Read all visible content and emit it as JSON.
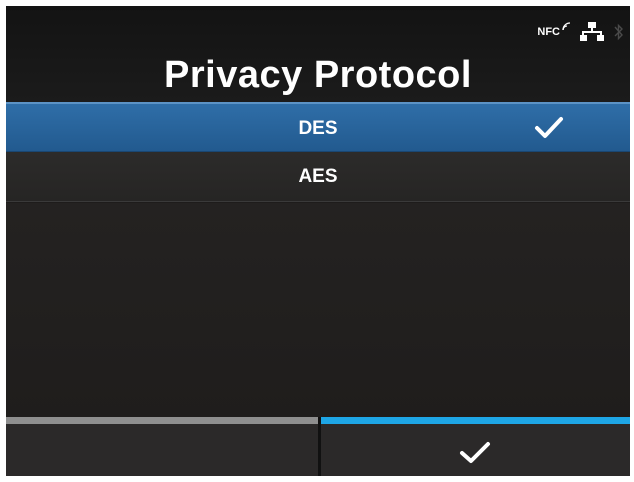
{
  "screen": {
    "title": "Privacy Protocol",
    "status": {
      "nfc_label": "NFC",
      "icons": [
        "nfc-icon",
        "network-icon",
        "bluetooth-icon"
      ]
    }
  },
  "options": [
    {
      "label": "DES",
      "selected": true
    },
    {
      "label": "AES",
      "selected": false
    }
  ],
  "softkeys": {
    "left": {
      "label": ""
    },
    "right": {
      "icon": "check-icon"
    }
  },
  "colors": {
    "selected_row": "#2668a3",
    "accent_blue": "#1ea6e6",
    "softkey_left_bar": "#8f8f8f",
    "background": "#1e1c1b"
  }
}
